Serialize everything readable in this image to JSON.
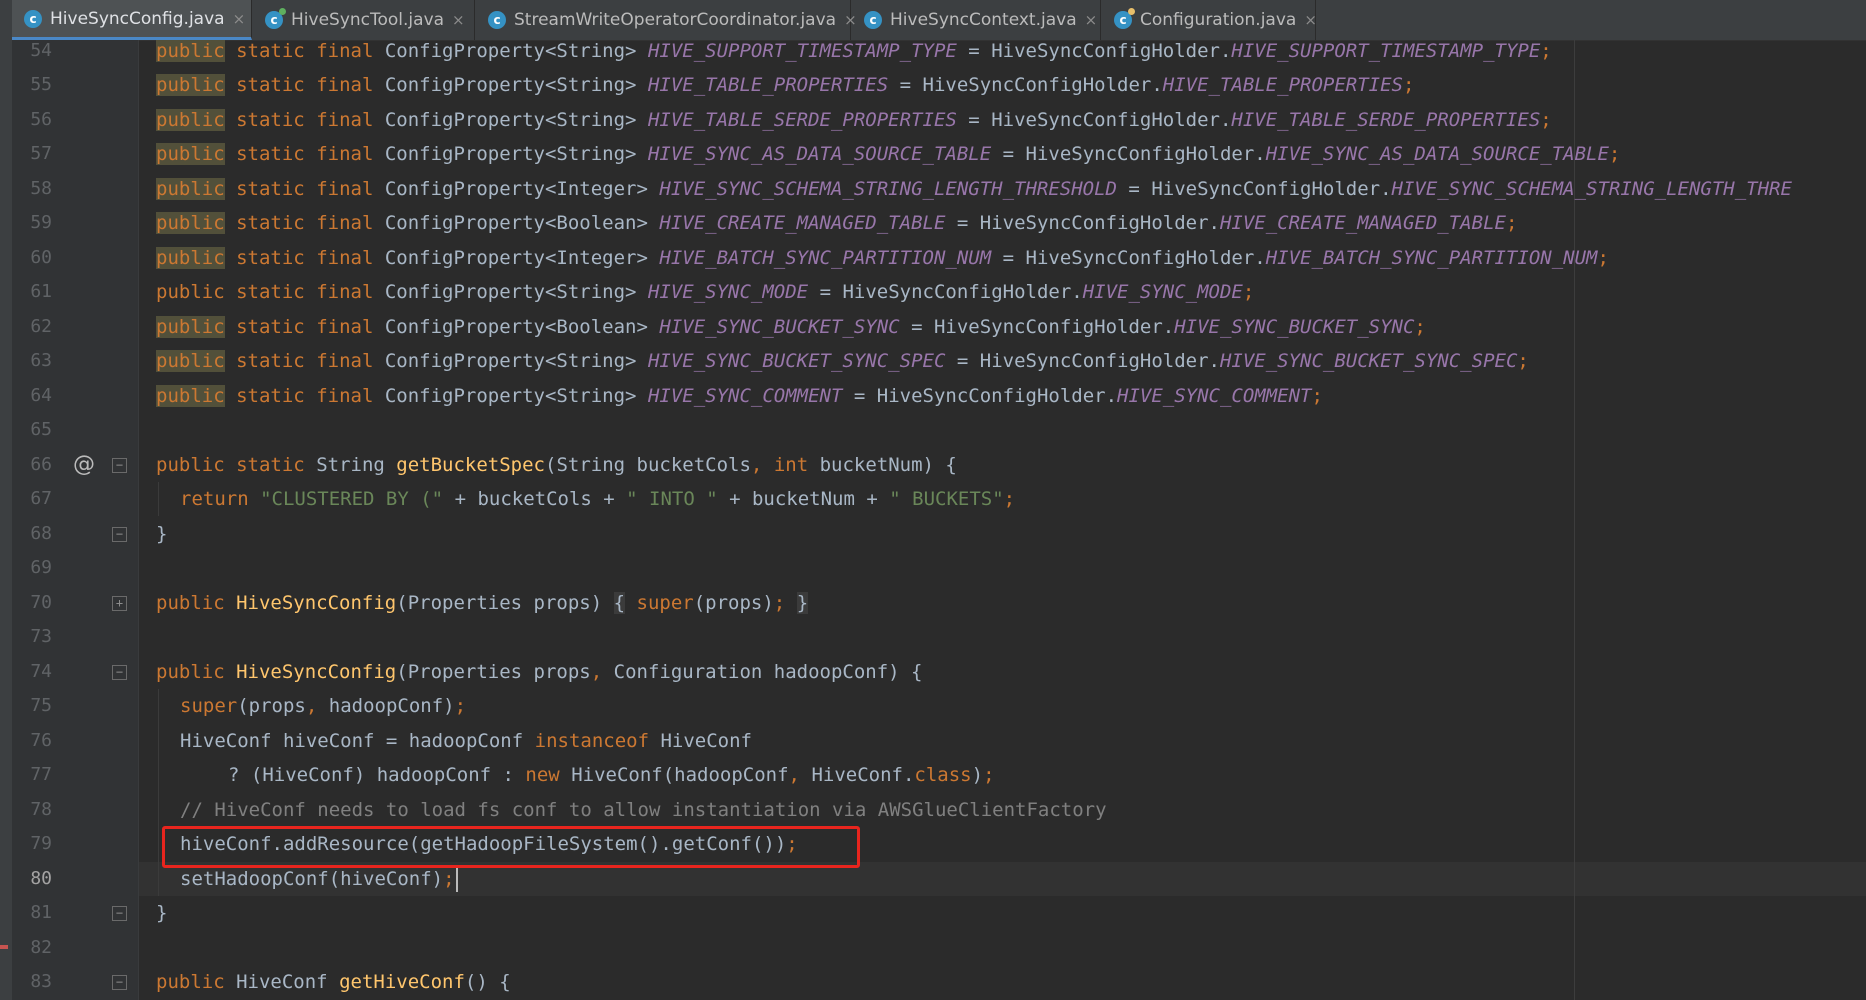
{
  "tabs": [
    {
      "label": "HiveSyncConfig.java",
      "active": true,
      "icon": "java-class-icon",
      "close": "×"
    },
    {
      "label": "HiveSyncTool.java",
      "active": false,
      "icon": "java-class-runnable-icon",
      "close": "×"
    },
    {
      "label": "StreamWriteOperatorCoordinator.java",
      "active": false,
      "icon": "java-class-icon",
      "close": "×"
    },
    {
      "label": "HiveSyncContext.java",
      "active": false,
      "icon": "java-class-icon",
      "close": "×"
    },
    {
      "label": "Configuration.java",
      "active": false,
      "icon": "java-class-locked-icon",
      "close": "×"
    }
  ],
  "gutter": {
    "line_numbers": [
      "54",
      "55",
      "56",
      "57",
      "58",
      "59",
      "60",
      "61",
      "62",
      "63",
      "64",
      "65",
      "66",
      "67",
      "68",
      "69",
      "70",
      "73",
      "74",
      "75",
      "76",
      "77",
      "78",
      "79",
      "80",
      "81",
      "82",
      "83"
    ],
    "current_line": "80",
    "override_marker": "@"
  },
  "code": {
    "lines": [
      {
        "n": "54",
        "public": "public",
        "static": "static",
        "final": "final",
        "type": "ConfigProperty<String>",
        "field": "HIVE_SUPPORT_TIMESTAMP_TYPE",
        "eq": "=",
        "holder": "HiveSyncConfigHolder.",
        "hfield": "HIVE_SUPPORT_TIMESTAMP_TYPE",
        "semi": ";"
      },
      {
        "n": "55",
        "public": "public",
        "static": "static",
        "final": "final",
        "type": "ConfigProperty<String>",
        "field": "HIVE_TABLE_PROPERTIES",
        "eq": "=",
        "holder": "HiveSyncConfigHolder.",
        "hfield": "HIVE_TABLE_PROPERTIES",
        "semi": ";"
      },
      {
        "n": "56",
        "public": "public",
        "static": "static",
        "final": "final",
        "type": "ConfigProperty<String>",
        "field": "HIVE_TABLE_SERDE_PROPERTIES",
        "eq": "=",
        "holder": "HiveSyncConfigHolder.",
        "hfield": "HIVE_TABLE_SERDE_PROPERTIES",
        "semi": ";"
      },
      {
        "n": "57",
        "public": "public",
        "static": "static",
        "final": "final",
        "type": "ConfigProperty<String>",
        "field": "HIVE_SYNC_AS_DATA_SOURCE_TABLE",
        "eq": "=",
        "holder": "HiveSyncConfigHolder.",
        "hfield": "HIVE_SYNC_AS_DATA_SOURCE_TABLE",
        "semi": ";"
      },
      {
        "n": "58",
        "public": "public",
        "static": "static",
        "final": "final",
        "type": "ConfigProperty<Integer>",
        "field": "HIVE_SYNC_SCHEMA_STRING_LENGTH_THRESHOLD",
        "eq": "=",
        "holder": "HiveSyncConfigHolder.",
        "hfield": "HIVE_SYNC_SCHEMA_STRING_LENGTH_THRE",
        "semi": ""
      },
      {
        "n": "59",
        "public": "public",
        "static": "static",
        "final": "final",
        "type": "ConfigProperty<Boolean>",
        "field": "HIVE_CREATE_MANAGED_TABLE",
        "eq": "=",
        "holder": "HiveSyncConfigHolder.",
        "hfield": "HIVE_CREATE_MANAGED_TABLE",
        "semi": ";"
      },
      {
        "n": "60",
        "public": "public",
        "static": "static",
        "final": "final",
        "type": "ConfigProperty<Integer>",
        "field": "HIVE_BATCH_SYNC_PARTITION_NUM",
        "eq": "=",
        "holder": "HiveSyncConfigHolder.",
        "hfield": "HIVE_BATCH_SYNC_PARTITION_NUM",
        "semi": ";"
      },
      {
        "n": "61",
        "public": "public",
        "static": "static",
        "final": "final",
        "type": "ConfigProperty<String>",
        "field": "HIVE_SYNC_MODE",
        "eq": "=",
        "holder": "HiveSyncConfigHolder.",
        "hfield": "HIVE_SYNC_MODE",
        "semi": ";"
      },
      {
        "n": "62",
        "public": "public",
        "static": "static",
        "final": "final",
        "type": "ConfigProperty<Boolean>",
        "field": "HIVE_SYNC_BUCKET_SYNC",
        "eq": "=",
        "holder": "HiveSyncConfigHolder.",
        "hfield": "HIVE_SYNC_BUCKET_SYNC",
        "semi": ";"
      },
      {
        "n": "63",
        "public": "public",
        "static": "static",
        "final": "final",
        "type": "ConfigProperty<String>",
        "field": "HIVE_SYNC_BUCKET_SYNC_SPEC",
        "eq": "=",
        "holder": "HiveSyncConfigHolder.",
        "hfield": "HIVE_SYNC_BUCKET_SYNC_SPEC",
        "semi": ";"
      },
      {
        "n": "64",
        "public": "public",
        "static": "static",
        "final": "final",
        "type": "ConfigProperty<String>",
        "field": "HIVE_SYNC_COMMENT",
        "eq": "=",
        "holder": "HiveSyncConfigHolder.",
        "hfield": "HIVE_SYNC_COMMENT",
        "semi": ";"
      }
    ],
    "l66": {
      "kw1": "public",
      "kw2": "static",
      "t1": "String",
      "fn": "getBucketSpec",
      "rest": "(String bucketCols",
      "comma": ",",
      "kwint": "int",
      "rest2": "bucketNum) {"
    },
    "l67": {
      "kw": "return",
      "s1": "\"CLUSTERED BY (\"",
      "p1": " + bucketCols + ",
      "s2": "\" INTO \"",
      "p2": " + bucketNum + ",
      "s3": "\" BUCKETS\"",
      "semi": ";"
    },
    "l68": {
      "text": "}"
    },
    "l70": {
      "kw": "public",
      "fn": "HiveSyncConfig",
      "args": "(Properties props)",
      "b1": "{",
      "kwsuper": "super",
      "call": "(props)",
      "semi": ";",
      "b2": "}"
    },
    "l74": {
      "kw": "public",
      "fn": "HiveSyncConfig",
      "a1": "(Properties props",
      "comma": ",",
      "a2": "Configuration hadoopConf) {"
    },
    "l75": {
      "kw": "super",
      "call": "(props",
      "comma": ",",
      "call2": "hadoopConf)",
      "semi": ";"
    },
    "l76": {
      "t1": "HiveConf hiveConf = hadoopConf",
      "kw": "instanceof",
      "t2": "HiveConf"
    },
    "l77": {
      "t1": "? (HiveConf) hadoopConf : ",
      "kw": "new",
      "t2": "HiveConf(hadoopConf",
      "comma": ",",
      "t3": "HiveConf.",
      "kwclass": "class",
      "t4": ")",
      "semi": ";"
    },
    "l78": {
      "text": "// HiveConf needs to load fs conf to allow instantiation via AWSGlueClientFactory"
    },
    "l79": {
      "text": "hiveConf.addResource(getHadoopFileSystem().getConf())",
      "semi": ";"
    },
    "l80": {
      "text": "setHadoopConf(hiveConf)",
      "semi": ";"
    },
    "l81": {
      "text": "}"
    },
    "l83": {
      "kw": "public",
      "t1": "HiveConf",
      "fn": "getHiveConf",
      "rest": "() {"
    }
  },
  "colors": {
    "background": "#2b2b2b",
    "keyword": "#cc7832",
    "field": "#9876aa",
    "function": "#ffc66d",
    "string": "#6a8759",
    "comment": "#808080",
    "highlight_box": "#e8251e"
  }
}
